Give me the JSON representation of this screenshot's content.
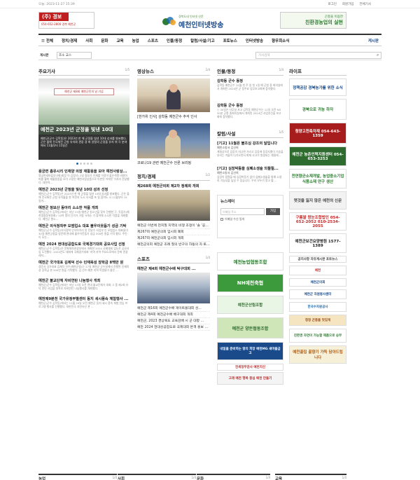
{
  "top": {
    "date": "오늘: 2023-11-27 15:39",
    "links": [
      "로그인",
      "회원가입",
      "전체기사"
    ]
  },
  "header": {
    "left_ad": {
      "title": "(주) 경보",
      "line": "054-652-2800 경북 예천군",
      "accent": "#c01f1f"
    },
    "logo": {
      "sub": "경북도내 인터넷 신문",
      "name": "예천인터넷방송",
      "mark": "YBS"
    },
    "right_ad": {
      "title": "곤충을 이용한",
      "sub": "친환경농업의 실현",
      "accent": "#2e7d32"
    }
  },
  "nav": {
    "items": [
      "전체",
      "정치/경제",
      "사회",
      "문화",
      "교육",
      "농업",
      "스포츠",
      "인물/동정",
      "칼럼/사설/기고",
      "포토뉴스",
      "인터넷방송",
      "향우회소식"
    ],
    "boards_label": "게시판"
  },
  "search": {
    "select_label": "게시판",
    "select_value": "조소 교스",
    "placeholder": "기사검색"
  },
  "col1": {
    "title": "주요기사",
    "page": "1/5",
    "slide_caption": "예천군 2023년 군정을 빛낸 10대",
    "slide_text": "예천군(군수 김학동)은 2023년 한 해 군정을 빛낸 10대 성과를 발표했다. 군은 올해 전국체전 군청 유치와 관광 경 화 양질의 군정을 유지 위 각 분야에서 11월부터 15일간",
    "slide_label": "예천군 제8회 예천군민의 날 기념",
    "articles": [
      {
        "title": "용궁면 흡유시리 인재양 의장 재활용을 모아 예천사랑상...",
        "body": "용궁면새마을부녀회(회장 이 김정녀) 2일 협부가 인재를 이정이 물은색명 비용아파를 활화 재활용품을 모아 고정된 예천사랑상품으로 아판된 이에웃 이처리 전달했다. 대한적..."
      },
      {
        "title": "예천군 2023년 군정을 빛낸 10대 성과 선정",
        "body": "예천군(군수 김학동)은 2023년 한 해 군정을 빛낸 10대 성과를 발표했다. 군은 올해 전국체전 군청 유치율을 한 여전의 도시 유서를 포 됨 참여도 시 11월부터 15일까..."
      },
      {
        "title": "예천군 정보산 동아리 소소한 작품 개최",
        "body": "예천군(군수 김학동)에서는 지난 23일 예천군 청소년을 찾아 진행한 구. 독립가(예천생협동위원회) '10여 명의 단가가 가협 '9개소 가 참여해 소소한 작품을 개최했다. 예천군 향소..."
      },
      {
        "title": "예천군 의식정착부 모범업소 대표 불우이웃돕기 성금 기탁",
        "body": "예천군(군수 김학동)의식정착 인식아이리 맛 전달수 사업부 인 모범업소 대표들이 30일 예천군청을 방문해 관내에 불우이웃돕기 성금 300만 원을 기탁 했다. 주민이 모은..."
      },
      {
        "title": "예천 2024 현대성공합도로 국제경기대회 공모사업 선정",
        "body": "예천군(군수 김학동)은 문화체육관광부에서 개최한 2024 국제대회 업도로 공모사업 도전했다. 2024년도 대회에 국제경기대회 '지역 지역 주요도로에서 문화 관광 레저..."
      },
      {
        "title": "예천군 국가대표 김제덕 선수 인재육성 장학금 8백만 원",
        "body": "경운사 국가대표 김제덕 선수(예천군청)는 27일 예천군 군수실에서 진행된 인재육성 장학금 본 500만 원을 기탁했다. 김 선수 예천 지역 학생들이 좋은 ..."
      },
      {
        "title": "예천군 불교단체 자비연탄 나눔행사 개최",
        "body": "예천군(군수 김학동)에서는 지난 23일 오전 관내 불교단체가 대회 그 중 제2회 유덕 연탄 사업을 대학로 자비연탄 나눔행사를 개최했다."
      },
      {
        "title": "예천제9분천 국가유정부별센터 동지 세시풍속 체험행사 ...",
        "body": "예천군(군수 김학동)에서는 11월 29일 오전 예천군 동지 세시 풍속 체험 연습 프로그램 행사를 진행했다. 대한민국 자연유산 관 ..."
      }
    ]
  },
  "col2": {
    "sec1": {
      "title": "영상뉴스",
      "page": "1/4",
      "items": [
        "[한가위 인사] 김학동 예천군수 추석 인사",
        "코로나19 관련 예천군수 언론 브리핑"
      ]
    },
    "sec2": {
      "title": "정치/경제",
      "page": "1/2",
      "feature": "제268회 예천군의회 제2차 정례회 개회",
      "lines": [
        "예천군 이번에 천지질 지역의 비쟁 조정이 '솔 '공영...",
        "제267회 예천군의회 임시회 폐회",
        "제267회 예천군의회 임시회 개회",
        "예천군의회 예천군 조례 질의 반구의 하동의 자 토론..."
      ]
    },
    "sec3": {
      "title": "스포츠",
      "page": "1/4",
      "feature": "예천군 제4회 예천군수배 탁구대회 ...",
      "lines": [
        "예천군 제16회 예천군수배 게이트볼대회 성...",
        "예천군 제4회 예천군수배 배구대회 개최",
        "예천군, 2023 경상북도 교육감배 시 군 대항 ...",
        "예천 2024 현대성공합도로 국제대회 본격 홍보 시작"
      ]
    }
  },
  "col3": {
    "sec1": {
      "title": "인물/동정",
      "page": "1/4",
      "items": [
        {
          "title": "김학동 군수 동정",
          "body": "김학동 예천군수 12월 첫 주 일 첫 1일 예 군청 중 회의실에서 개최된 2024년 군 정주요 업무보고회에 참석했다."
        },
        {
          "title": "김학동 군수 동정",
          "body": "○ 30일은 사무실 포고 김학동 예천군수는 11일 오전 9시 30분 군청 중회의실에서 개최된 2024년 사업추진을 보고회에 참석했다."
        }
      ]
    },
    "sec2": {
      "title": "칼럼/사설",
      "page": "1/5",
      "items": [
        {
          "title": "[기고] 11월은 불조심 강조의 달입니다",
          "body": ""
        },
        {
          "title": "예천소방서 김선희",
          "body": "계절상으로 입동이 지나면 거리고 입동에 동장지열이 기승을 부리는 겨울이 다가오면서 화재 사고가 발생되는 계절에..."
        },
        {
          "title": "[기고] 심장박동을 심폐소생술 되돌릴...",
          "body": ""
        },
        {
          "title": "예천소방서 김선희",
          "body": "심장이 멈췄을 때 심장박동기 없이 심폐소생술을 통해 소생의 가능성을 높일 수 있습니다. 우리 모두가 알고 할 ..."
        }
      ]
    },
    "newsletter": {
      "title": "뉴스레터",
      "placeholder": "이메일 주소",
      "button": "가입",
      "consent": "이메일 수신 동의"
    },
    "banners": [
      "예천농업협동조합",
      "NH예천축협",
      "예천군산림조합",
      "예천군 양돈협동조합",
      "내일을 준비하는 땅의 희망 예천MG 새마을금고",
      "전세정부감사 예천지신",
      "고래 예천 행복 중심 예천 만들기"
    ]
  },
  "col4": {
    "title": "라이프",
    "banners": [
      {
        "text": "정책공감 경북농가를 위한 소식",
        "bg": "#ffffff",
        "fg": "#1a4a8a"
      },
      {
        "text": "경북으로 귀농 하자",
        "bg": "#ffffff",
        "fg": "#2e7d32"
      },
      {
        "text": "청양고천축자재 054-643-1359",
        "bg": "#a71d1d",
        "fg": "#ffffff"
      },
      {
        "text": "예천군 농촌인력지원센터 054-653-3253",
        "bg": "#2e6b2e",
        "fg": "#ffffff"
      },
      {
        "text": "천연향균소재개발, 농업중소기업 식품소재 연구 생산",
        "bg": "#ffffff",
        "fg": "#2e7d32"
      },
      {
        "text": "옛것을 잃지 않은 예천의 신문",
        "bg": "#f2f2f2",
        "fg": "#444444"
      },
      {
        "text": "구름쌀 왕눈조합법인 054-652-2052 010-2534-2055",
        "bg": "#ffffff",
        "fg": "#c62828"
      },
      {
        "text": "예천군보건요양병원 1577-1389",
        "bg": "#ffffff",
        "fg": "#222222"
      },
      {
        "text": "공지사항 자유게시판 포토뉴스",
        "bg": "#ffffff",
        "fg": "#444444"
      },
      {
        "text": "예천",
        "bg": "#ffffff",
        "fg": "#c62828"
      },
      {
        "text": "예천군의회",
        "bg": "#ffffff",
        "fg": "#1a4a8a"
      },
      {
        "text": "예천군 자원봉사센터",
        "bg": "#ffffff",
        "fg": "#1a4a8a"
      },
      {
        "text": "한국수자원공사",
        "bg": "#ffffff",
        "fg": "#1a6ab0"
      },
      {
        "text": "청정 곤충을 맛있게",
        "bg": "#f5e5c0",
        "fg": "#9a4a1a"
      },
      {
        "text": "친환경 자연이 가능할 제품으로 승부",
        "bg": "#ffffff",
        "fg": "#2e7d32"
      },
      {
        "text": "예천꿀집 꿀향기 가득 담아드립니다",
        "bg": "#f7f0d8",
        "fg": "#b05a10"
      }
    ]
  },
  "bottom": [
    {
      "title": "농업",
      "page": "1/4"
    },
    {
      "title": "사회",
      "page": "1/4"
    },
    {
      "title": "문화",
      "page": "1/4"
    },
    {
      "title": "교육",
      "page": "1/4"
    }
  ]
}
